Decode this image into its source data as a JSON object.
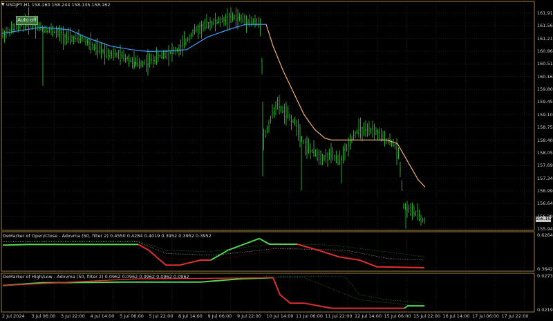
{
  "header": {
    "arrow": "▼",
    "symbol_info": "USDJPY,H1  158.160 158.244 158.135 158.162",
    "auto_button": "Auto off"
  },
  "main_axis": {
    "labels": [
      "161.910",
      "161.560",
      "161.210",
      "160.860",
      "160.510",
      "160.160",
      "159.800",
      "159.450",
      "159.100",
      "158.750",
      "158.400",
      "158.050",
      "157.690",
      "157.340",
      "156.990",
      "156.640",
      "156.290",
      "155.940"
    ],
    "current_price": "156.162"
  },
  "indicator1": {
    "title": "DeMarker of Open/Close - Adxvma (50, filter 2) 0.4550 0.4284 0.4019 0.3952 0.3952 0.3952",
    "axis_labels": [
      "0.6264",
      "0.3642"
    ]
  },
  "indicator2": {
    "title": "DeMarker of High/Low - Adxvma (50, filter 2) 0.0962 0.0962 0.0962 0.0962 0.0962",
    "axis_labels": [
      "0.0273",
      "0.0219"
    ]
  },
  "time_axis": [
    "2 Jul 2024",
    "3 Jul 06:00",
    "3 Jul 22:00",
    "4 Jul 14:00",
    "5 Jul 06:00",
    "5 Jul 22:00",
    "8 Jul 14:00",
    "9 Jul 06:00",
    "9 Jul 22:00",
    "10 Jul 14:00",
    "11 Jul 06:00",
    "11 Jul 22:00",
    "12 Jul 14:00",
    "15 Jul 06:00",
    "15 Jul 22:00",
    "16 Jul 14:00",
    "17 Jul 06:00",
    "17 Jul 22:00"
  ],
  "colors": {
    "candles": "#2fd22f",
    "ma_up": "#3da0ff",
    "ma_down": "#f4b27a",
    "grid": "#3a3a5a",
    "frame": "#c8a050",
    "demarker_up": "#50d850",
    "demarker_down": "#e03030",
    "band_dotted": "#2a9a2a",
    "mid_dotted": "#d0d0d0",
    "lower_dotted": "#8a1a1a"
  }
}
